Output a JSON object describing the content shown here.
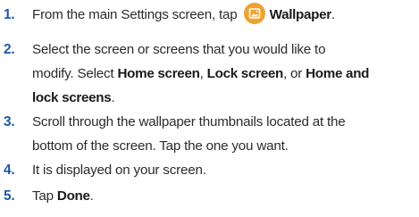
{
  "steps": [
    {
      "number": "1.",
      "text_before": "From the main Settings screen, tap",
      "icon": "wallpaper-icon",
      "bold": "Wallpaper",
      "text_after": "."
    },
    {
      "number": "2.",
      "line1": "Select the screen or screens that you would like to",
      "line2_text1": "modify. Select ",
      "bold1": "Home screen",
      "line2_text2": ", ",
      "bold2": "Lock screen",
      "line2_text3": ", or ",
      "bold3a": "Home and",
      "bold3b": "lock screens",
      "line3_text": "."
    },
    {
      "number": "3.",
      "line1": "Scroll through the wallpaper thumbnails located at the",
      "line2": "bottom of the screen. Tap the one you want."
    },
    {
      "number": "4.",
      "line1": "It is displayed on your screen."
    },
    {
      "number": "5.",
      "text_before": "Tap ",
      "bold": "Done",
      "text_after": "."
    }
  ],
  "colors": {
    "number": "#1d5aa6",
    "icon_bg": "#f0a230",
    "text": "#2b2b2b"
  }
}
